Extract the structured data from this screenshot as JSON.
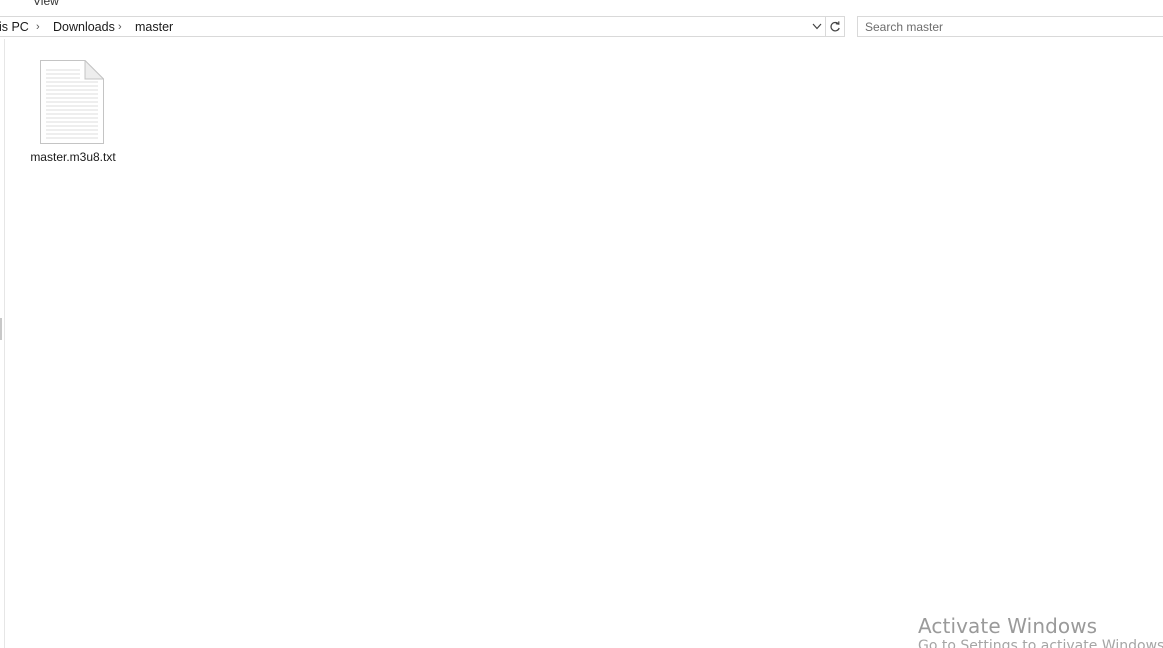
{
  "ribbon": {
    "tabs": [
      {
        "label": ""
      },
      {
        "label": "View"
      }
    ]
  },
  "address": {
    "breadcrumbs": [
      "his PC",
      "Downloads",
      "master"
    ],
    "separator": "›"
  },
  "search": {
    "placeholder": "Search master"
  },
  "files": [
    {
      "name": "master.m3u8.txt",
      "icon": "text-file-icon"
    }
  ],
  "watermark": {
    "title": "Activate Windows",
    "subtitle": "Go to Settings to activate Windows."
  },
  "colors": {
    "background": "#ffffff",
    "border": "#d9d9d9",
    "watermark": "#9a9a9a"
  }
}
